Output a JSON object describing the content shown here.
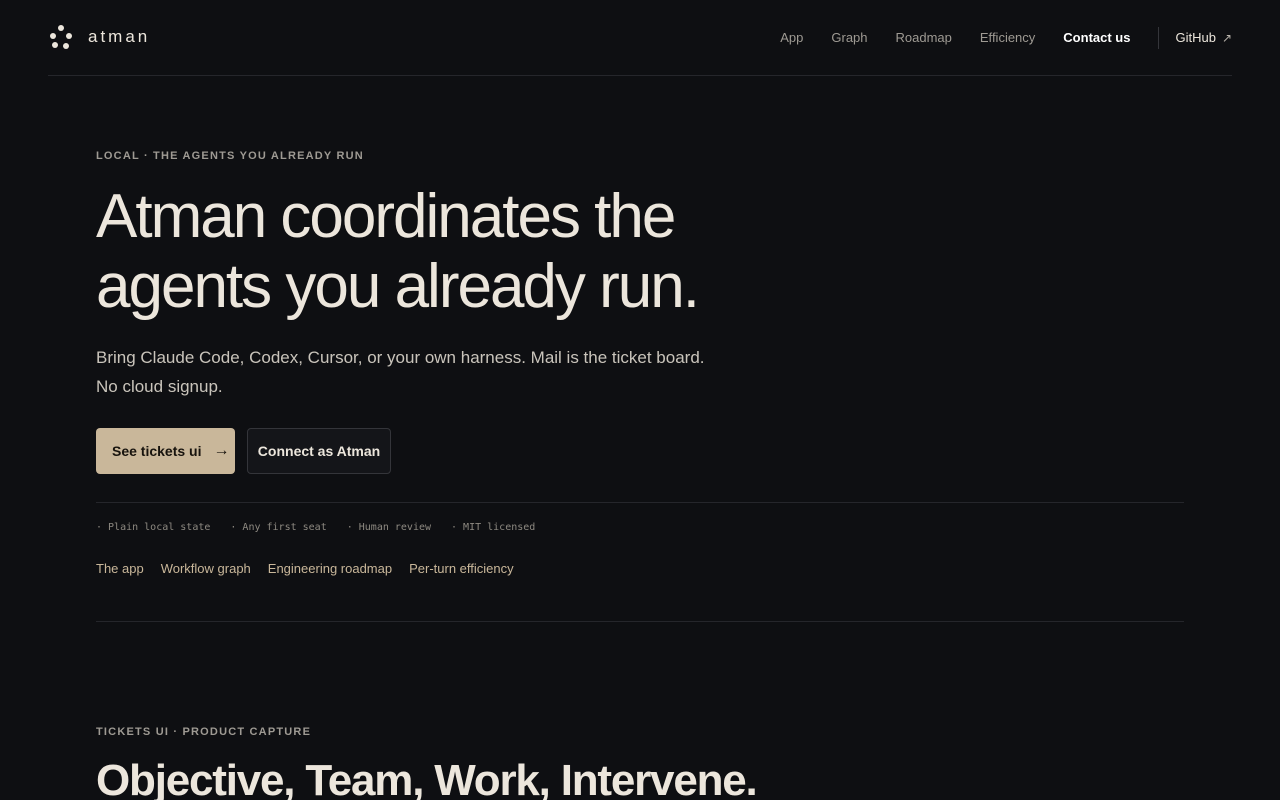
{
  "brand": {
    "name": "atman",
    "logo_icon": "dots-cluster-icon"
  },
  "nav": {
    "links": [
      "App",
      "Graph",
      "Roadmap",
      "Efficiency"
    ],
    "contact": "Contact us",
    "github": "GitHub",
    "github_icon": "external-arrow-icon"
  },
  "hero": {
    "eyebrow": "LOCAL · THE AGENTS YOU ALREADY RUN",
    "title_line1": "Atman coordinates the",
    "title_line2": "agents you already run.",
    "subtitle": "Bring Claude Code, Codex, Cursor, or your own harness. Mail is the ticket board. No cloud signup.",
    "primary_cta": "See tickets ui",
    "primary_cta_icon": "arrow-right-icon",
    "secondary_cta": "Connect as Atman"
  },
  "features": [
    "· Plain local state",
    "· Any first seat",
    "· Human review",
    "· MIT licensed"
  ],
  "links": [
    "The app",
    "Workflow graph",
    "Engineering roadmap",
    "Per-turn efficiency"
  ],
  "section": {
    "eyebrow": "TICKETS UI · PRODUCT CAPTURE",
    "title": "Objective, Team, Work, Intervene."
  },
  "colors": {
    "background": "#0e0f12",
    "text": "#ece6dc",
    "muted": "#9e9a93",
    "accent": "#c9b79a"
  }
}
